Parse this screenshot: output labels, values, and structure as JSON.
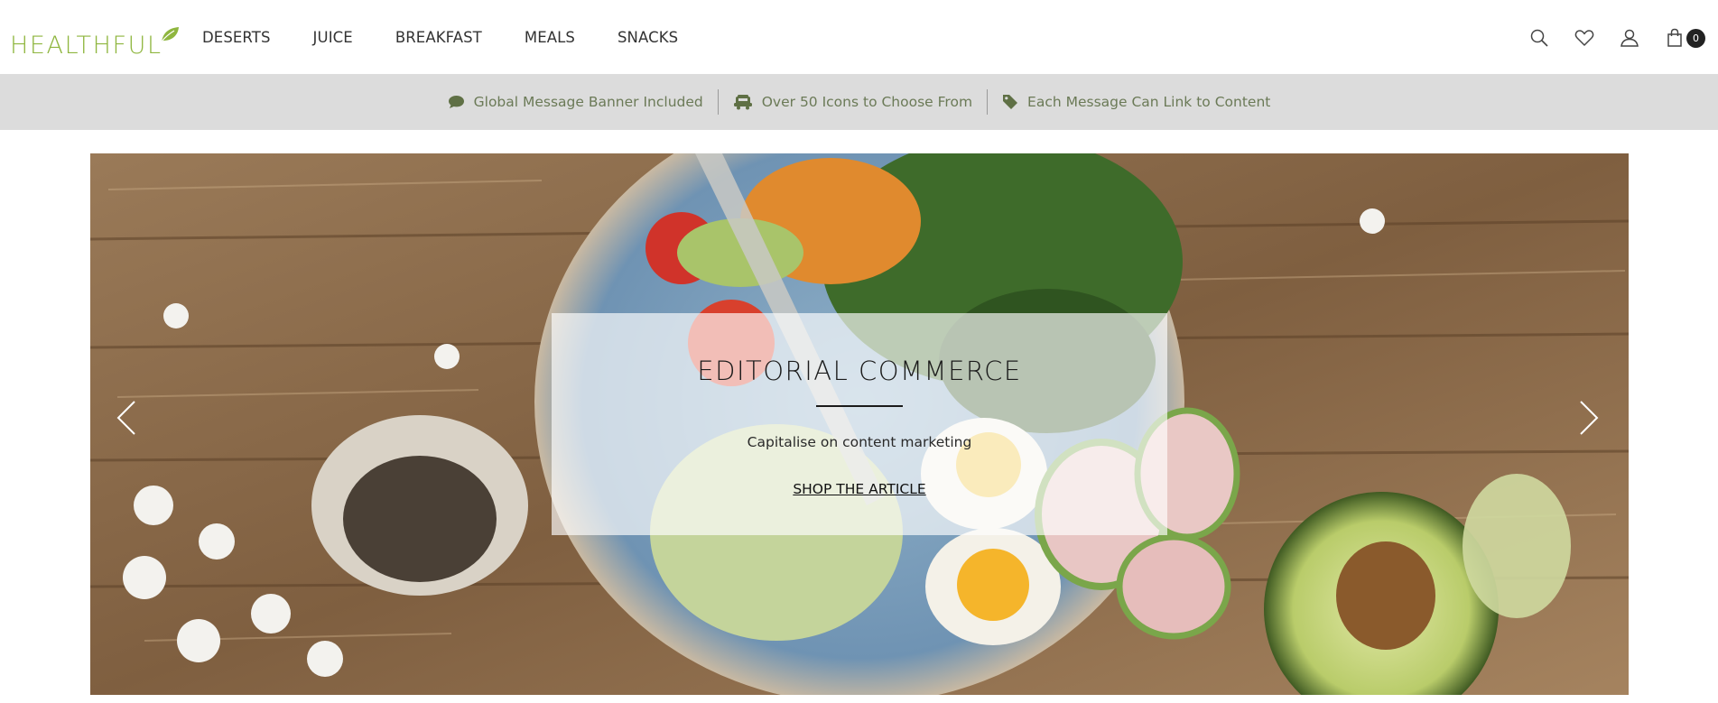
{
  "header": {
    "logo_text": "HEALTHFUL",
    "brand_color": "#8fb63f",
    "nav": [
      {
        "label": "DESERTS"
      },
      {
        "label": "JUICE"
      },
      {
        "label": "BREAKFAST"
      },
      {
        "label": "MEALS"
      },
      {
        "label": "SNACKS"
      }
    ],
    "icons": [
      "search-icon",
      "heart-icon",
      "user-icon",
      "cart-icon"
    ],
    "cart_count": "0"
  },
  "announcement": {
    "background": "#dcdcdc",
    "text_color": "#6b7a57",
    "messages": [
      {
        "icon": "chat-bubble-icon",
        "text": "Global Message Banner Included"
      },
      {
        "icon": "truck-icon",
        "text": "Over 50 Icons to Choose From"
      },
      {
        "icon": "tag-icon",
        "text": "Each Message Can Link to Content"
      }
    ]
  },
  "hero": {
    "title": "EDITORIAL COMMERCE",
    "subtitle": "Capitalise on content marketing",
    "link_label": "SHOP THE ARTICLE",
    "prev_icon": "chevron-left-icon",
    "next_icon": "chevron-right-icon"
  }
}
